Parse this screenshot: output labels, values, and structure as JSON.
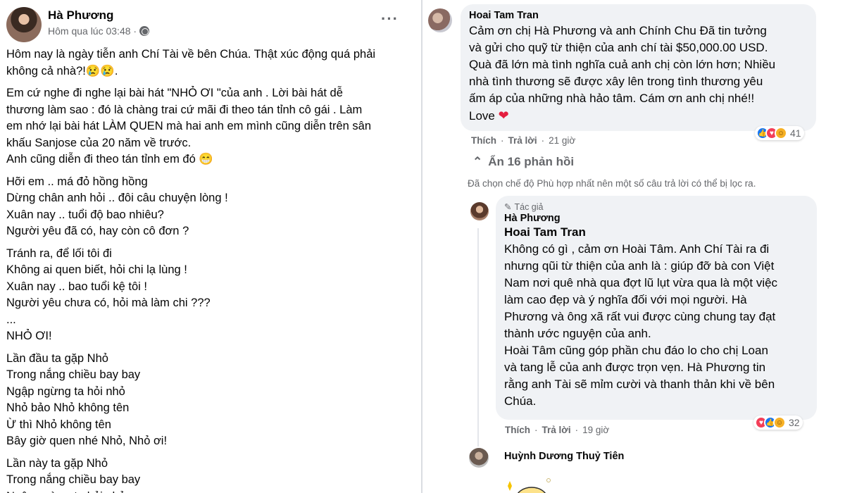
{
  "post": {
    "author": "Hà Phương",
    "timestamp": "Hôm qua lúc 03:48 ·",
    "more_icon": "three-dots-icon",
    "paragraphs": [
      [
        "Hôm nay là ngày tiễn anh Chí Tài về bên Chúa. Thật xúc động quá phải",
        "không cả nhà?!😢😢."
      ],
      [
        "Em cứ nghe đi nghe lại bài hát \"NHỎ ƠI \"của anh . Lời bài hát dễ",
        "thương làm sao : đó là chàng trai cứ mãi đi theo tán tỉnh cô gái . Làm",
        "em nhớ lại bài hát LÀM QUEN mà hai anh em mình cũng diễn trên sân",
        "khấu Sanjose của 20 năm về trước.",
        "Anh cũng diễn đi theo tán tỉnh em đó 😁"
      ],
      [
        "Hỡi em .. má đỏ hồng hồng",
        "Dừng chân anh hỏi .. đôi câu chuyện lòng !",
        "Xuân nay .. tuổi độ bao nhiêu?",
        "Người yêu đã có, hay còn cô đơn ?"
      ],
      [
        "Tránh ra, để lối tôi đi",
        "Không ai quen biết, hỏi chi lạ lùng !",
        "Xuân nay .. bao tuổi kệ tôi !",
        "Người yêu chưa có, hỏi mà làm chi ???",
        "...",
        "NHỎ ƠI!"
      ],
      [
        "Lần đầu ta gặp Nhỏ",
        "Trong nắng chiều bay bay",
        "Ngập ngừng ta hỏi nhỏ",
        "Nhỏ bảo Nhỏ không tên",
        "Ừ thì Nhỏ không tên",
        "Bây giờ quen nhé Nhỏ, Nhỏ ơi!"
      ],
      [
        "Lần này ta gặp Nhỏ",
        "Trong nắng chiều bay bay",
        "Ngập ngừng ta hỏi nhỏ"
      ]
    ]
  },
  "comments": {
    "c1": {
      "name": "Hoai Tam Tran",
      "lines": [
        "Cảm ơn chị Hà Phương và anh Chính Chu Đã tin tưởng",
        "và gửi cho quỹ từ thiện của anh chí tài $50,000.00 USD.",
        "Quà đã lớn mà tình nghĩa cuả anh chị còn lớn hơn; Nhiều",
        "nhà tình thương sẽ được xây lên trong tình thương yêu",
        "ấm áp của những nhà hảo tâm. Cám ơn anh chị nhé!!"
      ],
      "last_line": "Love",
      "heart": "❤",
      "like": "Thích",
      "reply": "Trả lời",
      "time": "21 giờ",
      "reaction_count": "41"
    },
    "hidden_replies": "Ẩn 16 phản hồi",
    "filter_note": "Đã chọn chế độ Phù hợp nhất nên một số câu trả lời có thể bị lọc ra.",
    "c2": {
      "badge": "Tác giả",
      "name": "Hà Phương",
      "tagged": "Hoai Tam Tran",
      "lines": [
        "Không có gì , cảm ơn Hoài Tâm. Anh Chí Tài ra đi",
        "nhưng qũi từ thiện của anh là : giúp đỡ bà con Việt",
        "Nam nơi quê nhà qua đợt lũ lụt vừa qua là một việc",
        "làm cao đẹp và ý nghĩa đối với mọi người. Hà",
        "Phương và ông xã rất vui được cùng chung tay đạt",
        "thành ước nguyện của anh.",
        "Hoài Tâm cũng góp phần chu đáo lo cho chị Loan",
        "và tang lễ của anh được trọn vẹn. Hà Phương tin",
        "rằng anh Tài sẽ mỉm cười và thanh thản khi về bên",
        "Chúa."
      ],
      "like": "Thích",
      "reply": "Trả lời",
      "time": "19 giờ",
      "reaction_count": "32"
    },
    "c3": {
      "name": "Huỳnh Dương Thuỷ Tiên"
    }
  },
  "colors": {
    "secondary_text": "#65676b",
    "bubble_bg": "#f0f2f5",
    "like_blue": "#1877f2",
    "love_red": "#f33e58",
    "care_yellow": "#f7b125"
  }
}
